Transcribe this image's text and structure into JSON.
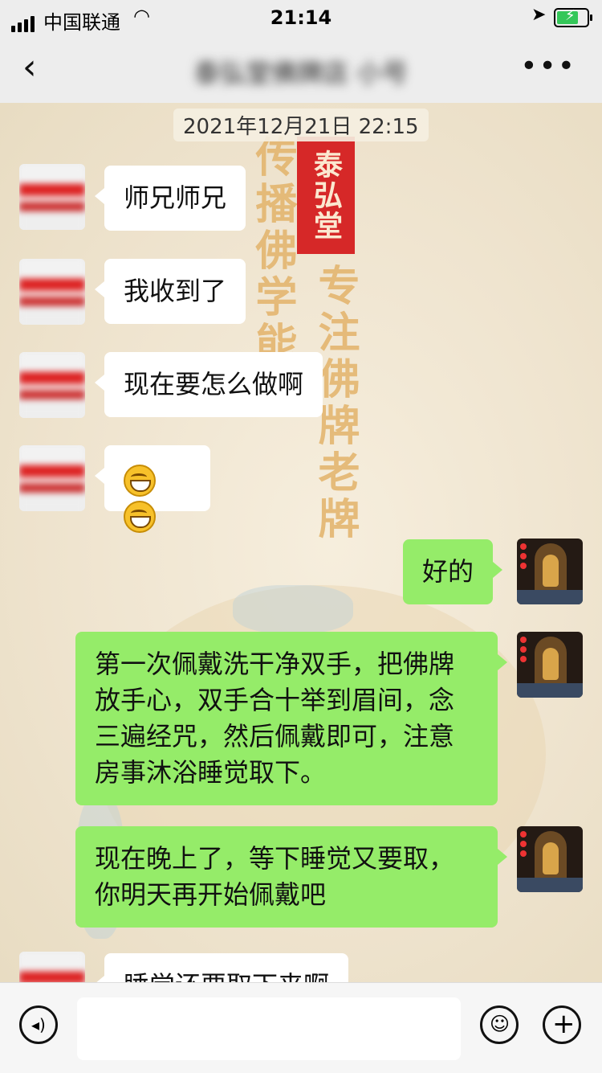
{
  "status_bar": {
    "carrier": "中国联通",
    "time": "21:14",
    "wifi_icon": "wifi-icon",
    "location_icon": "location-arrow-icon",
    "battery_state": "charging"
  },
  "nav": {
    "back_icon": "chevron-left-icon",
    "title": "泰弘堂佛牌店 小号",
    "more_icon": "more-dots-icon"
  },
  "wallpaper": {
    "seal": "泰弘堂",
    "col_left": "传播佛学能量",
    "col_right": "专注佛牌老牌"
  },
  "chat": {
    "timestamp": "2021年12月21日 22:15",
    "messages": [
      {
        "side": "left",
        "text": "师兄师兄"
      },
      {
        "side": "left",
        "text": "我收到了"
      },
      {
        "side": "left",
        "text": "现在要怎么做啊"
      },
      {
        "side": "left",
        "emoji": "grinning-face-icon",
        "count": 2
      },
      {
        "side": "right",
        "text": "好的"
      },
      {
        "side": "right",
        "text": "第一次佩戴洗干净双手，把佛牌放手心，双手合十举到眉间，念三遍经咒，然后佩戴即可，注意房事沐浴睡觉取下。"
      },
      {
        "side": "right",
        "text": "现在晚上了，等下睡觉又要取，你明天再开始佩戴吧"
      },
      {
        "side": "left",
        "text": "睡觉还要取下来啊"
      }
    ]
  },
  "input_bar": {
    "voice_icon": "voice-icon",
    "emoji_icon": "emoji-icon",
    "plus_icon": "plus-icon",
    "voice_glyph": "◂)",
    "emoji_glyph": "☺",
    "plus_glyph": "+"
  },
  "colors": {
    "bubble_self": "#95ec69",
    "bubble_other": "#ffffff",
    "bar_bg": "#ededed"
  }
}
